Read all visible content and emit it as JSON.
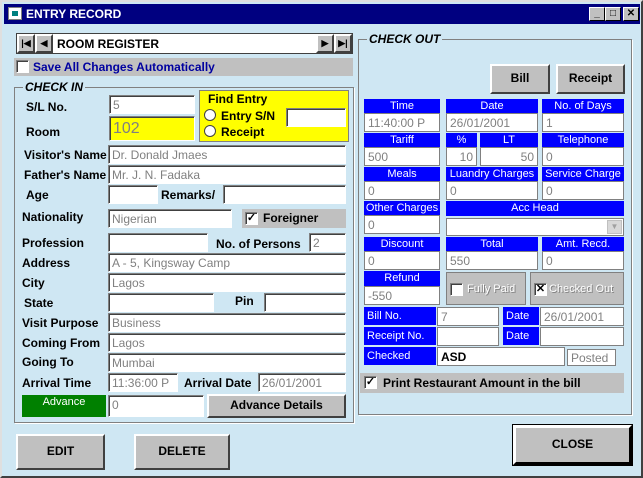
{
  "window": {
    "title": "ENTRY RECORD"
  },
  "nav": {
    "label": "ROOM REGISTER",
    "first": "|◀",
    "prev": "◀",
    "next": "▶",
    "last": "▶|"
  },
  "save_all": {
    "label": "Save All Changes Automatically",
    "checked": false
  },
  "checkin": {
    "title": "CHECK IN",
    "sl_no_label": "S/L No.",
    "sl_no": "5",
    "room_label": "Room",
    "room": "102",
    "find_entry": {
      "title": "Find Entry",
      "opt1": "Entry S/N",
      "opt2": "Receipt",
      "value": ""
    },
    "visitor_label": "Visitor's Name",
    "visitor": "Dr. Donald Jmaes",
    "father_label": "Father's Name",
    "father": "Mr. J. N. Fadaka",
    "age_label": "Age",
    "age": "",
    "remarks_label": "Remarks/",
    "remarks": "",
    "nationality_label": "Nationality",
    "nationality": "Nigerian",
    "foreigner_label": "Foreigner",
    "foreigner_checked": true,
    "profession_label": "Profession",
    "profession": "",
    "persons_label": "No. of Persons",
    "persons": "2",
    "address_label": "Address",
    "address": "A - 5, Kingsway Camp",
    "city_label": "City",
    "city": "Lagos",
    "state_label": "State",
    "state": "",
    "pin_label": "Pin",
    "pin": "",
    "purpose_label": "Visit Purpose",
    "purpose": "Business",
    "coming_label": "Coming From",
    "coming": "Lagos",
    "going_label": "Going To",
    "going": "Mumbai",
    "arrival_time_label": "Arrival Time",
    "arrival_time": "11:36:00 P",
    "arrival_date_label": "Arrival Date",
    "arrival_date": "26/01/2001",
    "advance_label": "Advance",
    "advance": "0",
    "advance_details": "Advance Details"
  },
  "checkout": {
    "title": "CHECK OUT",
    "bill_btn": "Bill",
    "receipt_btn": "Receipt",
    "time_label": "Time",
    "time": "11:40:00 P",
    "date_label": "Date",
    "date": "26/01/2001",
    "days_label": "No. of Days",
    "days": "1",
    "tariff_label": "Tariff",
    "tariff": "500",
    "pct_label": "%",
    "pct": "10",
    "lt_label": "LT",
    "lt": "50",
    "telephone_label": "Telephone",
    "telephone": "0",
    "meals_label": "Meals",
    "meals": "0",
    "laundry_label": "Luandry Charges",
    "laundry": "0",
    "service_label": "Service Charge",
    "service": "0",
    "other_label": "Other Charges",
    "other": "0",
    "acc_head_label": "Acc Head",
    "acc_head": "",
    "discount_label": "Discount",
    "discount": "0",
    "total_label": "Total",
    "total": "550",
    "amt_recd_label": "Amt. Recd.",
    "amt_recd": "0",
    "refund_label": "Refund",
    "refund": "-550",
    "fully_paid": "Fully Paid",
    "checked_out": "Checked Out",
    "bill_no_label": "Bill No.",
    "bill_no": "7",
    "bill_date_label": "Date",
    "bill_date": "26/01/2001",
    "receipt_no_label": "Receipt No.",
    "receipt_no": "",
    "receipt_date_label": "Date",
    "receipt_date": "",
    "checked_label": "Checked",
    "checked_by": "ASD",
    "posted": "Posted",
    "print_label": "Print Restaurant Amount in the bill"
  },
  "buttons": {
    "edit": "EDIT",
    "delete": "DELETE",
    "close": "CLOSE"
  },
  "colors": {
    "title": "#000080",
    "accent": "#0000ff",
    "highlight": "#ffff00",
    "advance": "#008000",
    "panel": "#cfe7f3"
  }
}
